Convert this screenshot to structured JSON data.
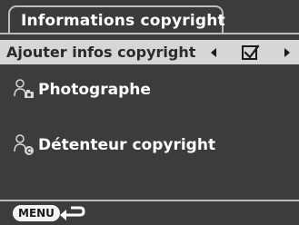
{
  "header": {
    "title": "Informations copyright"
  },
  "selected_row": {
    "label": "Ajouter infos copyright",
    "checked": true
  },
  "fields": [
    {
      "label": "Photographe",
      "icon": "photographer-icon"
    },
    {
      "label": "Détenteur copyright",
      "icon": "copyright-holder-icon"
    }
  ],
  "footer": {
    "menu_label": "MENU",
    "back_icon": "back-arrow-icon"
  },
  "colors": {
    "background": "#3c3c3c",
    "highlight": "#d6d6d6",
    "border": "#bdbdbd",
    "text": "#ffffff"
  }
}
